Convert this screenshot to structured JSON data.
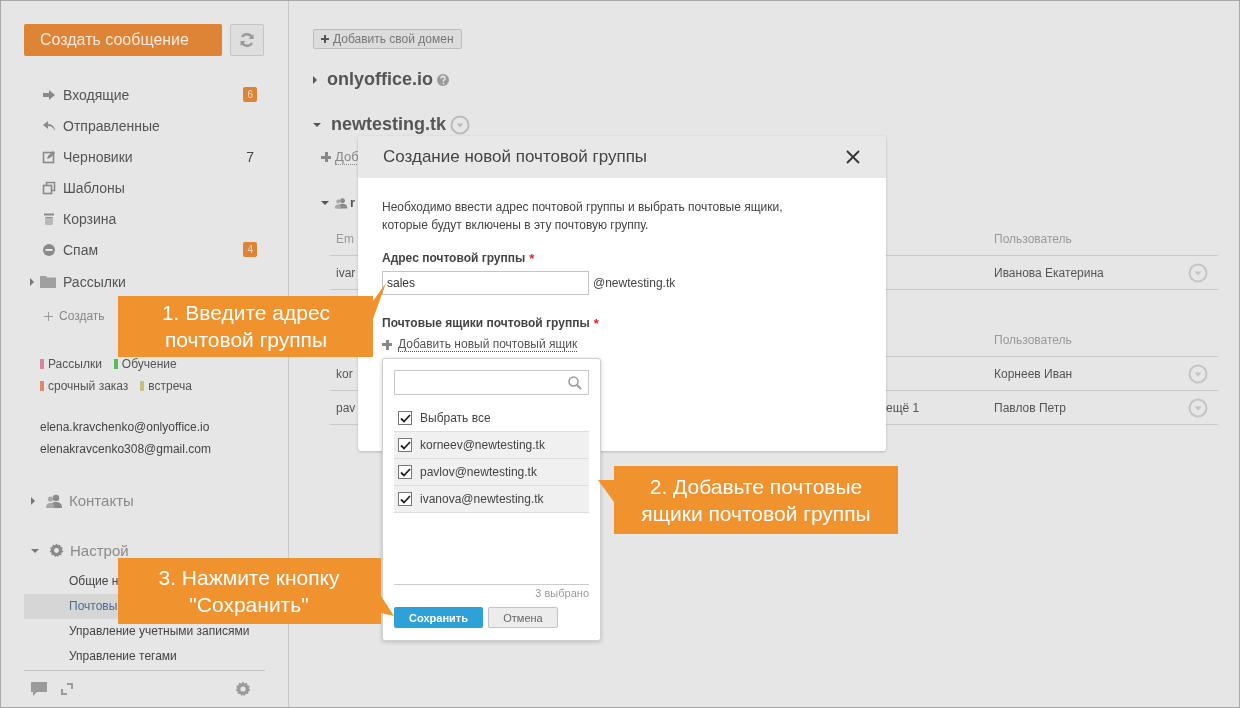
{
  "sidebar": {
    "compose_button": "Создать сообщение",
    "folders": [
      {
        "kind": "inbox",
        "label": "Входящие",
        "counter": "6",
        "highlighted": true
      },
      {
        "kind": "sent",
        "label": "Отправленные"
      },
      {
        "kind": "drafts",
        "label": "Черновики",
        "counter": "7",
        "highlighted": false
      },
      {
        "kind": "templates",
        "label": "Шаблоны"
      },
      {
        "kind": "trash",
        "label": "Корзина"
      },
      {
        "kind": "spam",
        "label": "Спам",
        "counter": "4",
        "highlighted": true
      }
    ],
    "user_folders": {
      "label": "Рассылки",
      "expanded": false
    },
    "create_link": "Создать",
    "tags": [
      {
        "label": "Рассылки",
        "color": "#d4879c"
      },
      {
        "label": "Обучение",
        "color": "#5cb85c"
      },
      {
        "label": "срочный заказ",
        "color": "#e08a6a"
      },
      {
        "label": "встреча",
        "color": "#c8c07a"
      }
    ],
    "accounts": [
      "elena.kravchenko@onlyoffice.io",
      "elenakravcenko308@gmail.com"
    ],
    "contacts": {
      "label": "Контакты",
      "expanded": false
    },
    "settings": {
      "label": "Настрой",
      "expanded": true,
      "items": [
        {
          "label": "Общие н",
          "selected": false
        },
        {
          "label": "Почтовы",
          "selected": true
        },
        {
          "label": "Управление учетными записями",
          "selected": false
        },
        {
          "label": "Управление тегами",
          "selected": false
        }
      ]
    }
  },
  "main": {
    "add_domain_button": "Добавить свой домен",
    "domains": [
      {
        "name": "onlyoffice.io",
        "expanded": false
      },
      {
        "name": "newtesting.tk",
        "expanded": true
      }
    ],
    "add_link": "Доб",
    "group_name": "r",
    "tables": [
      {
        "header": {
          "column_1": "Em",
          "column_3": "Пользователь"
        },
        "rows": [
          {
            "column_1": "ivar",
            "column_3": "Иванова Екатерина"
          }
        ]
      },
      {
        "header": {
          "column_3": "Пользователь"
        },
        "rows": [
          {
            "column_1": "kor",
            "column_3": "Корнеев Иван"
          },
          {
            "column_1": "pav",
            "column_2": "ещё 1",
            "column_3": "Павлов Петр"
          }
        ]
      }
    ]
  },
  "dialog": {
    "title": "Создание новой почтовой группы",
    "description": "Необходимо ввести адрес почтовой группы и выбрать почтовые ящики, которые будут включены в эту почтовую группу.",
    "address_label": {
      "text": "Адрес почтовой группы",
      "required_mark": "*"
    },
    "address_value": "sales",
    "domain_suffix": "@newtesting.tk",
    "mailboxes_label": {
      "text": "Почтовые ящики почтовой группы",
      "required_mark": "*"
    },
    "add_mailbox_link": "Добавить новый почтовый ящик"
  },
  "dropdown": {
    "select_all": {
      "label": "Выбрать все",
      "checked": true
    },
    "items": [
      {
        "label": "korneev@newtesting.tk",
        "checked": true
      },
      {
        "label": "pavlov@newtesting.tk",
        "checked": true
      },
      {
        "label": "ivanova@newtesting.tk",
        "checked": true
      }
    ],
    "selected_count": "3 выбрано",
    "save_button": "Сохранить",
    "cancel_button": "Отмена"
  },
  "callouts": [
    {
      "text": "1. Введите адрес почтовой группы"
    },
    {
      "text": "2. Добавьте почтовые ящики почтовой группы"
    },
    {
      "text": "3. Нажмите кнопку \"Сохранить\""
    }
  ]
}
